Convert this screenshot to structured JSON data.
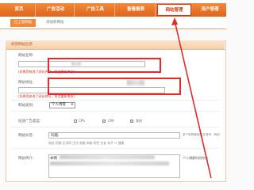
{
  "nav": {
    "items": [
      {
        "label": "首页"
      },
      {
        "label": "广告活动"
      },
      {
        "label": "广告工具"
      },
      {
        "label": "查看报表"
      },
      {
        "label": "网站管理"
      },
      {
        "label": "用户管理"
      }
    ],
    "active_index": 4
  },
  "subtabs": {
    "active": "已上架网站",
    "other": "添加新网站"
  },
  "panel": {
    "title": "修改网站信息",
    "site_name_label": "网站名称:",
    "site_name_hint": "(如果您修改了网站名称，将会重新审核)",
    "site_url_label": "网站地址:",
    "site_url_hint": "(如果您修改了网站地址，将会重新审核)",
    "site_type_label": "网站类别:",
    "site_type_value": "个人博客",
    "ad_type_label": "投放广告类型:",
    "ad_types": [
      "CPS",
      "CPA",
      "其他"
    ],
    "site_tags_label": "网站标签:",
    "site_tags_value": "同趣,",
    "site_tags_hint": "多个标签使用英文逗号，网站",
    "categories": "网站 同城 名词同 生活 电脑 网络 软件 交友 亲子 IT 健康",
    "site_intro_label": "网站简介:",
    "site_intro_value": "本网",
    "site_intro_hint": "个人博客时间完成"
  },
  "colors": {
    "accent": "#e06418",
    "highlight": "#e02b2b"
  }
}
